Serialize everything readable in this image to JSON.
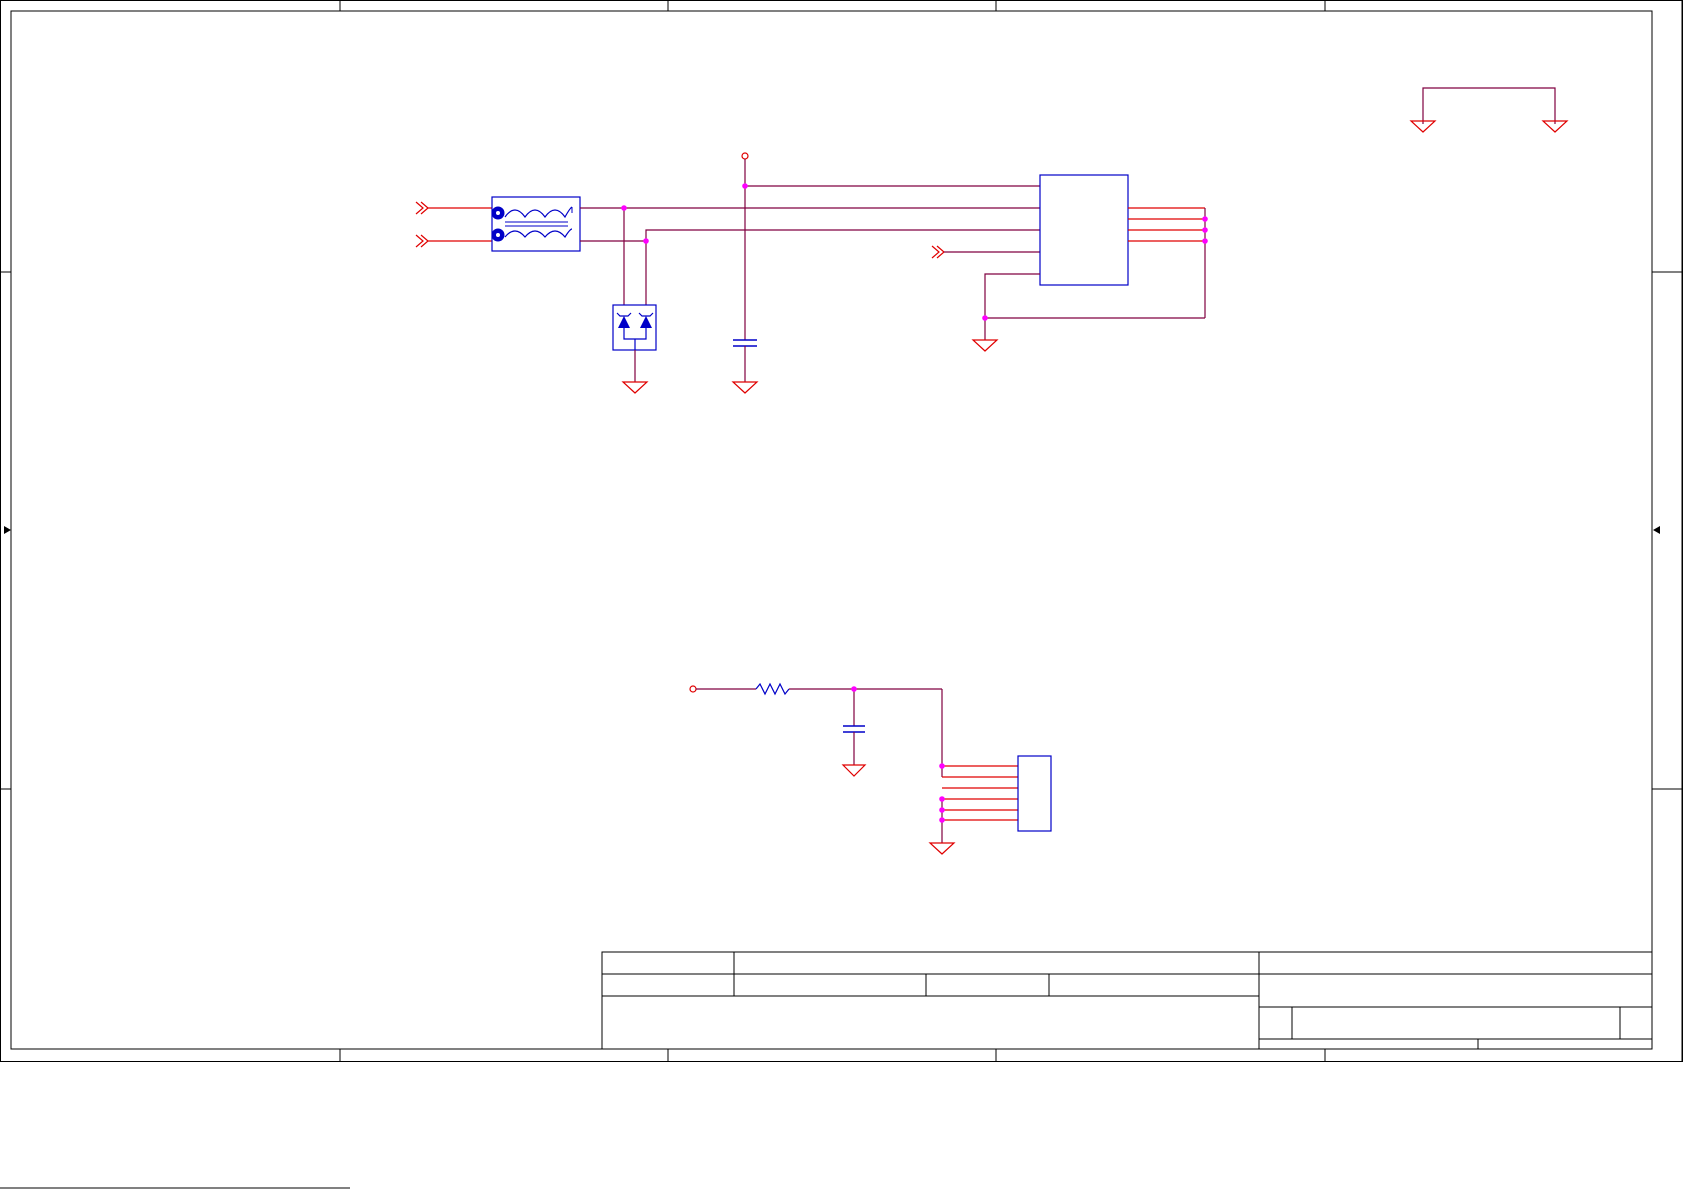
{
  "document": {
    "type": "schematic-sheet",
    "colors": {
      "frame": "#000000",
      "wire": "#800040",
      "net_red": "#e00000",
      "component": "#0000c8",
      "junction": "#ff00ff"
    }
  },
  "components": [
    {
      "id": "common-mode-choke",
      "icon": "choke-symbol"
    },
    {
      "id": "tvs-diode-array",
      "icon": "dual-tvs-diode-symbol"
    },
    {
      "id": "decoupling-capacitor-top",
      "icon": "capacitor-symbol"
    },
    {
      "id": "transceiver-ic",
      "icon": "ic-box-symbol"
    },
    {
      "id": "series-resistor",
      "icon": "resistor-symbol"
    },
    {
      "id": "filter-capacitor-bottom",
      "icon": "capacitor-symbol"
    },
    {
      "id": "connector-header",
      "icon": "connector-symbol"
    }
  ],
  "symbols": {
    "ground": "ground-icon",
    "offpage_connector": "double-chevron-icon",
    "power_port": "open-circle-icon",
    "junction": "junction-dot-icon"
  },
  "title_block": {
    "cells": [
      "",
      "",
      "",
      "",
      "",
      "",
      "",
      "",
      "",
      "",
      "",
      ""
    ]
  }
}
